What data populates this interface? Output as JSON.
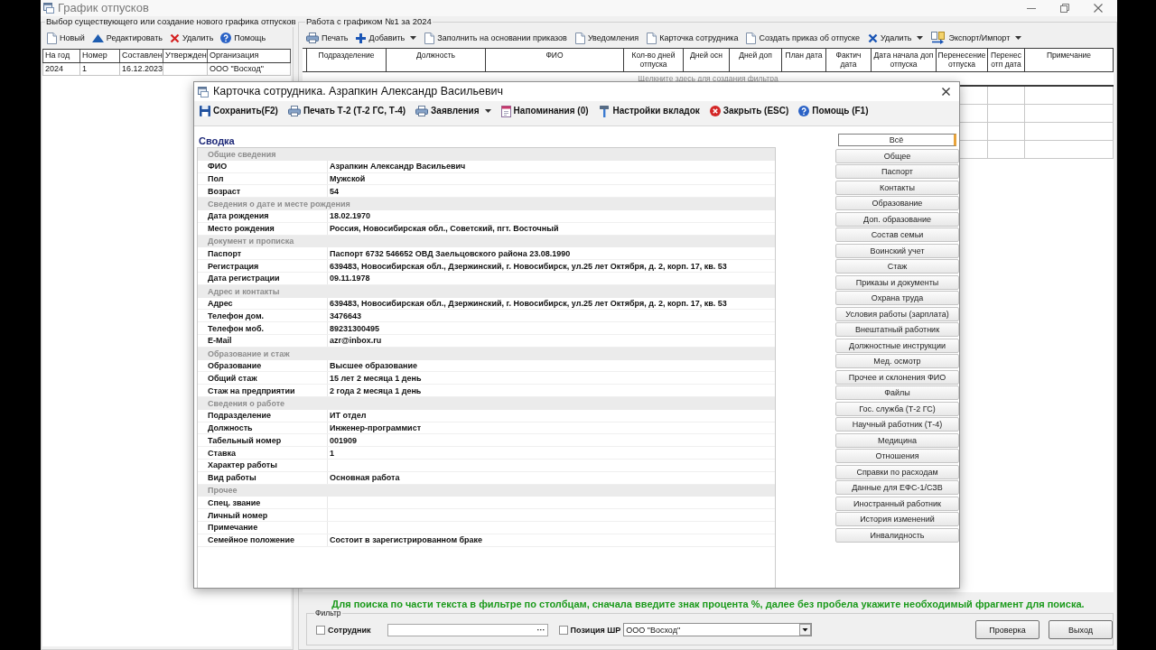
{
  "window": {
    "title": "График отпусков"
  },
  "schedule_list": {
    "title": "Выбор существующего или создание нового графика отпусков",
    "toolbar": [
      {
        "label": "Новый"
      },
      {
        "label": "Редактировать"
      },
      {
        "label": "Удалить"
      },
      {
        "label": "Помощь"
      }
    ],
    "columns": [
      "На год",
      "Номер",
      "Составлен",
      "Утвержден",
      "Организация"
    ],
    "rows": [
      [
        "2024",
        "1",
        "16.12.2023",
        null,
        "ООО \"Восход\""
      ]
    ]
  },
  "schedule_work": {
    "title": "Работа с графиком №1 за 2024",
    "toolbar": [
      {
        "label": "Печать",
        "dropdown": false
      },
      {
        "label": "Добавить",
        "dropdown": true
      },
      {
        "label": "Заполнить на основании приказов",
        "dropdown": false
      },
      {
        "label": "Уведомления",
        "dropdown": false
      },
      {
        "label": "Карточка сотрудника",
        "dropdown": false
      },
      {
        "label": "Создать приказ об отпуске",
        "dropdown": false
      },
      {
        "label": "Удалить",
        "dropdown": true
      },
      {
        "label": "Экспорт/Импорт",
        "dropdown": true
      }
    ],
    "columns": [
      "Подразделение",
      "Должность",
      "ФИО",
      "Кол-во дней отпуска",
      "Дней осн",
      "Дней доп",
      "План дата",
      "Фактич дата",
      "Дата начала доп отпуска",
      "Перенесение отпуска",
      "Перенес отп дата",
      "Примечание"
    ],
    "filter_row_hint": "Щелкните здесь для создания фильтра",
    "search_hint": "Для поиска по части текста в фильтре по столбцам, сначала введите знак процента %, далее без пробела укажите необходимый фрагмент для поиска.",
    "filter": {
      "title": "Фильтр",
      "employee": {
        "label": "Сотрудник",
        "checked": false,
        "browse": "···"
      },
      "position": {
        "label": "Позиция ШР",
        "checked": false,
        "value": "ООО \"Восход\""
      }
    },
    "buttons": [
      "Проверка",
      "Выход"
    ]
  },
  "employee_card": {
    "title": "Карточка сотрудника. Азрапкин Александр Васильевич",
    "toolbar": [
      {
        "label": "Сохранить(F2)",
        "dropdown": false
      },
      {
        "label": "Печать Т-2 (Т-2 ГС, Т-4)",
        "dropdown": false
      },
      {
        "label": "Заявления",
        "dropdown": true
      },
      {
        "label": "Напоминания (0)",
        "dropdown": false
      },
      {
        "label": "Настройки вкладок",
        "dropdown": false
      },
      {
        "label": "Закрыть (ESC)",
        "dropdown": false
      },
      {
        "label": "Помощь (F1)",
        "dropdown": false
      }
    ],
    "heading": "Сводка",
    "sections": [
      {
        "title": "Общие сведения",
        "fields": [
          {
            "label": "ФИО",
            "value": "Азрапкин Александр Васильевич"
          },
          {
            "label": "Пол",
            "value": "Мужской"
          },
          {
            "label": "Возраст",
            "value": "54"
          }
        ]
      },
      {
        "title": "Сведения о дате и месте рождения",
        "fields": [
          {
            "label": "Дата рождения",
            "value": "18.02.1970"
          },
          {
            "label": "Место рождения",
            "value": "Россия, Новосибирская обл., Советский, пгт. Восточный"
          }
        ]
      },
      {
        "title": "Документ и прописка",
        "fields": [
          {
            "label": "Паспорт",
            "value": "Паспорт 6732 546652 ОВД Заельцовского района 23.08.1990"
          },
          {
            "label": "Регистрация",
            "value": "639483, Новосибирская обл., Дзержинский, г. Новосибирск, ул.25 лет Октября, д. 2, корп. 17, кв. 53"
          },
          {
            "label": "Дата регистрации",
            "value": "09.11.1978"
          }
        ]
      },
      {
        "title": "Адрес и контакты",
        "fields": [
          {
            "label": "Адрес",
            "value": "639483, Новосибирская обл., Дзержинский, г. Новосибирск, ул.25 лет Октября, д. 2, корп. 17, кв. 53"
          },
          {
            "label": "Телефон дом.",
            "value": "3476643"
          },
          {
            "label": "Телефон моб.",
            "value": "89231300495"
          },
          {
            "label": "E-Mail",
            "value": "azr@inbox.ru"
          }
        ]
      },
      {
        "title": "Образование и стаж",
        "fields": [
          {
            "label": "Образование",
            "value": "Высшее образование"
          },
          {
            "label": "Общий стаж",
            "value": "15 лет 2 месяца 1 день"
          },
          {
            "label": "Стаж на предприятии",
            "value": "2 года 2 месяца 1 день"
          }
        ]
      },
      {
        "title": "Сведения о работе",
        "fields": [
          {
            "label": "Подразделение",
            "value": "ИТ отдел"
          },
          {
            "label": "Должность",
            "value": "Инженер-программист"
          },
          {
            "label": "Табельный номер",
            "value": "001909"
          },
          {
            "label": "Ставка",
            "value": "1"
          },
          {
            "label": "Характер работы"
          },
          {
            "label": "Вид работы",
            "value": "Основная работа"
          }
        ]
      },
      {
        "title": "Прочее",
        "fields": [
          {
            "label": "Спец. звание"
          },
          {
            "label": "Личный номер"
          },
          {
            "label": "Примечание"
          },
          {
            "label": "Семейное положение",
            "value": "Состоит в зарегистрированном браке"
          }
        ]
      }
    ],
    "tabs": [
      {
        "label": "Всё",
        "selected": true
      },
      {
        "label": "Общее",
        "selected": false
      },
      {
        "label": "Паспорт",
        "selected": false
      },
      {
        "label": "Контакты",
        "selected": false
      },
      {
        "label": "Образование",
        "selected": false
      },
      {
        "label": "Доп. образование",
        "selected": false
      },
      {
        "label": "Состав семьи",
        "selected": false
      },
      {
        "label": "Воинский учет",
        "selected": false
      },
      {
        "label": "Стаж",
        "selected": false
      },
      {
        "label": "Приказы и документы",
        "selected": false
      },
      {
        "label": "Охрана труда",
        "selected": false
      },
      {
        "label": "Условия работы (зарплата)",
        "selected": false
      },
      {
        "label": "Внештатный работник",
        "selected": false
      },
      {
        "label": "Должностные инструкции",
        "selected": false
      },
      {
        "label": "Мед. осмотр",
        "selected": false
      },
      {
        "label": "Прочее и склонения ФИО",
        "selected": false
      },
      {
        "label": "Файлы",
        "selected": false
      },
      {
        "label": "Гос. служба (Т-2 ГС)",
        "selected": false
      },
      {
        "label": "Научный работник (Т-4)",
        "selected": false
      },
      {
        "label": "Медицина",
        "selected": false
      },
      {
        "label": "Отношения",
        "selected": false
      },
      {
        "label": "Справки по расходам",
        "selected": false
      },
      {
        "label": "Данные для ЕФС-1/СЗВ",
        "selected": false
      },
      {
        "label": "Иностранный работник",
        "selected": false
      },
      {
        "label": "История изменений",
        "selected": false
      },
      {
        "label": "Инвалидность",
        "selected": false
      }
    ]
  }
}
